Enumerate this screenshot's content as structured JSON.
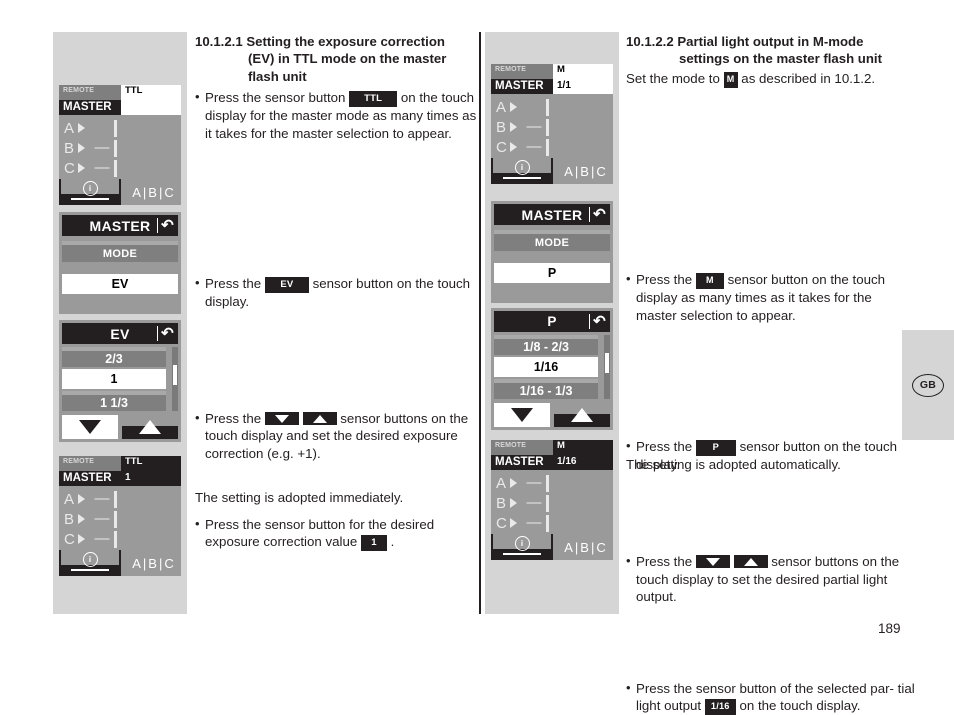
{
  "page": {
    "number": "189",
    "language_badge": "GB"
  },
  "left_column": {
    "heading": {
      "number": "10.1.2.1",
      "line1": "Setting the exposure correction",
      "line2": "(EV) in TTL mode on the master",
      "line3": "flash unit"
    },
    "para1": {
      "before": "Press the sensor button",
      "key": "TTL",
      "after": "on the touch display for the master mode as many times as it takes for the master selection to appear."
    },
    "para2": {
      "before": "Press the",
      "key": "EV",
      "after": "sensor button on the touch display."
    },
    "para3": {
      "before": "Press the",
      "key_down": "down-arrow",
      "key_up": "up-arrow",
      "after": "sensor buttons on the touch display and set the desired exposure correction (e.g. +1)."
    },
    "para4": {
      "before": "Press the sensor button for the desired exposure correction value",
      "key": "1",
      "after": "."
    },
    "para5": "The setting is adopted immediately."
  },
  "right_column": {
    "heading": {
      "number": "10.1.2.2",
      "line1": "Partial light output in M-mode",
      "line2": "settings on the master flash unit"
    },
    "para0": {
      "before": "Set the mode to",
      "key": "M",
      "after": "as described in 10.1.2."
    },
    "para1": {
      "before": "Press the",
      "key": "M",
      "after": "sensor button on the touch display as many times as it takes for the master selection to appear."
    },
    "para2": {
      "before": "Press the",
      "key": "P",
      "after": "sensor button on the touch display."
    },
    "para3": {
      "before": "Press the",
      "key_down": "down-arrow",
      "key_up": "up-arrow",
      "after": "sensor buttons on the touch display to set the desired partial light output."
    },
    "para4": {
      "before": "Press the sensor button of the selected par-tial light output",
      "before_l1": "Press the sensor button of the selected par-",
      "before_l2": "tial light output",
      "key": "1/16",
      "after": "on the touch display."
    },
    "para5": "The setting is adopted automatically."
  },
  "lcd_left_1": {
    "type": "status",
    "remote_label": "REMOTE",
    "master_label": "MASTER",
    "mode_line1": "TTL",
    "mode_line2": "",
    "groups": [
      {
        "name": "A",
        "value": ""
      },
      {
        "name": "B",
        "value": "—"
      },
      {
        "name": "C",
        "value": "—"
      }
    ],
    "footer_info": "i",
    "footer_groups": [
      "A",
      "B",
      "C"
    ]
  },
  "lcd_left_2": {
    "type": "menu",
    "title": "MASTER",
    "back_icon": "back-arrow",
    "label": "MODE",
    "value": "EV"
  },
  "lcd_left_3": {
    "type": "list",
    "title": "EV",
    "back_icon": "back-arrow",
    "rows": [
      {
        "text": "2/3",
        "selected": false
      },
      {
        "text": "1",
        "selected": true
      },
      {
        "text": "1 1/3",
        "selected": false
      }
    ],
    "btn_down": "down-arrow",
    "btn_up": "up-arrow"
  },
  "lcd_left_4": {
    "type": "status",
    "remote_label": "REMOTE",
    "master_label": "MASTER",
    "mode_line1": "TTL",
    "mode_line2": "1",
    "dark_mode_box": true,
    "groups": [
      {
        "name": "A",
        "value": "—"
      },
      {
        "name": "B",
        "value": "—"
      },
      {
        "name": "C",
        "value": "—"
      }
    ],
    "footer_info": "i",
    "footer_groups": [
      "A",
      "B",
      "C"
    ]
  },
  "lcd_right_1": {
    "type": "status",
    "remote_label": "REMOTE",
    "master_label": "MASTER",
    "mode_line1": "M",
    "mode_line2": "1/1",
    "dark_mode_box": false,
    "groups": [
      {
        "name": "A",
        "value": ""
      },
      {
        "name": "B",
        "value": "—"
      },
      {
        "name": "C",
        "value": "—"
      }
    ],
    "footer_info": "i",
    "footer_groups": [
      "A",
      "B",
      "C"
    ]
  },
  "lcd_right_2": {
    "type": "menu",
    "title": "MASTER",
    "back_icon": "back-arrow",
    "label": "MODE",
    "value": "P"
  },
  "lcd_right_3": {
    "type": "list",
    "title": "P",
    "back_icon": "back-arrow",
    "rows": [
      {
        "text": "1/8 - 2/3",
        "selected": false
      },
      {
        "text": "1/16",
        "selected": true
      },
      {
        "text": "1/16 - 1/3",
        "selected": false
      }
    ],
    "btn_down": "down-arrow",
    "btn_up": "up-arrow"
  },
  "lcd_right_4": {
    "type": "status",
    "remote_label": "REMOTE",
    "master_label": "MASTER",
    "mode_line1": "M",
    "mode_line2": "1/16",
    "dark_mode_box": true,
    "groups": [
      {
        "name": "A",
        "value": "—"
      },
      {
        "name": "B",
        "value": "—"
      },
      {
        "name": "C",
        "value": "—"
      }
    ],
    "footer_info": "i",
    "footer_groups": [
      "A",
      "B",
      "C"
    ]
  }
}
